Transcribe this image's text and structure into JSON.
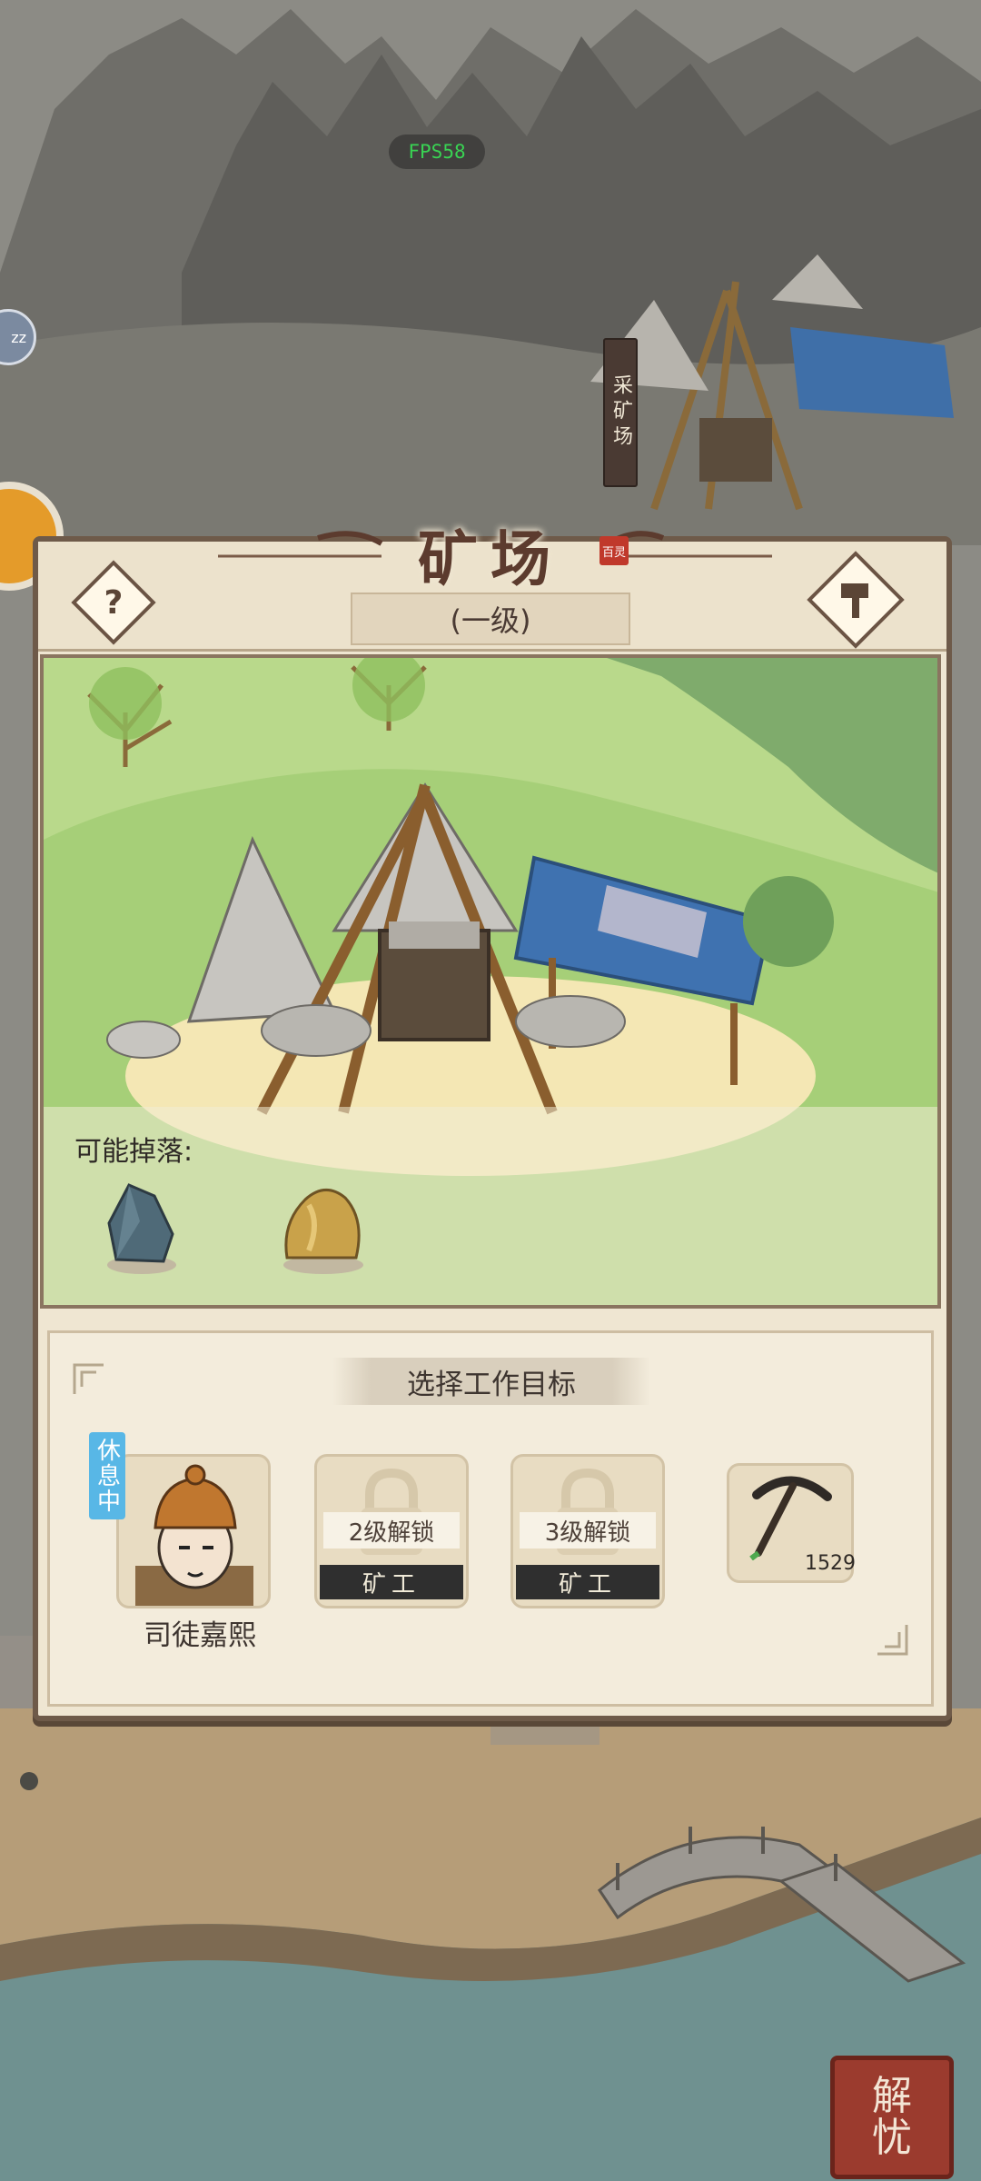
{
  "hud": {
    "fps_label": "FPS58"
  },
  "map": {
    "mine_banner": "采矿场",
    "side_badge": "zz"
  },
  "panel": {
    "title": "矿场",
    "title_stamp": "百灵",
    "level": "(一级)",
    "help_symbol": "?",
    "drops_label": "可能掉落:",
    "drops": [
      {
        "name": "ore-stone-icon"
      },
      {
        "name": "gold-nugget-icon"
      }
    ],
    "work_target_title": "选择工作目标",
    "worker": {
      "status": "休息中",
      "name": "司徒嘉熙"
    },
    "locked_slots": [
      {
        "unlock_label": "2级解锁",
        "role": "矿工"
      },
      {
        "unlock_label": "3级解锁",
        "role": "矿工"
      }
    ],
    "tool": {
      "icon": "pickaxe-icon",
      "count": "1529"
    }
  },
  "seal_button": {
    "line1": "解",
    "line2": "忧"
  }
}
